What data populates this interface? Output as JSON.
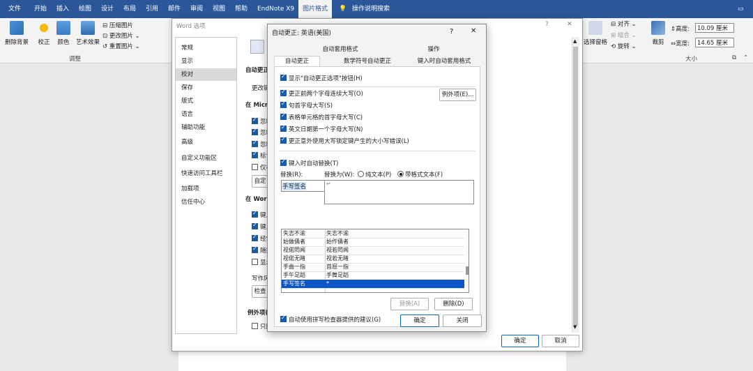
{
  "ribbon": {
    "tabs": [
      "文件",
      "开始",
      "插入",
      "绘图",
      "设计",
      "布局",
      "引用",
      "邮件",
      "审阅",
      "视图",
      "帮助",
      "EndNote X9",
      "图片格式",
      "操作说明搜索"
    ],
    "active_tab": "图片格式",
    "left_buttons": [
      "删除背景",
      "校正",
      "颜色",
      "艺术效果"
    ],
    "small_buttons": [
      "压缩图片",
      "更改图片",
      "重置图片"
    ],
    "group_adjust": "调整",
    "right_small": [
      "对齐",
      "组合",
      "旋转"
    ],
    "select_pane": "选择窗格",
    "crop": "裁剪",
    "height_label": "高度:",
    "height_value": "10.09 厘米",
    "width_label": "宽度:",
    "width_value": "14.65 厘米",
    "group_size": "大小"
  },
  "word_options": {
    "title": "Word 选项",
    "nav": [
      "常规",
      "显示",
      "校对",
      "保存",
      "版式",
      "语言",
      "辅助功能",
      "高级",
      "自定义功能区",
      "快速访问工具栏",
      "加载项",
      "信任中心"
    ],
    "nav_selected": "校对",
    "section_autocorrect": "自动更正",
    "change_text": "更改键",
    "section_micro": "在 Micro",
    "checks_micro": [
      "忽略",
      "忽略",
      "忽略",
      "标记",
      "仅根"
    ],
    "btn_custom": "自定",
    "section_word": "在 Word",
    "checks_word": [
      "键入",
      "键入",
      "经常",
      "随拼",
      "显示"
    ],
    "writing_label": "写作风",
    "btn_check": "检查",
    "exception_label": "例外项(",
    "only_label": "只隐",
    "ok": "确定",
    "cancel": "取消",
    "help": "?",
    "close": "✕"
  },
  "autocorrect": {
    "title": "自动更正: 英语(美国)",
    "help": "?",
    "close": "✕",
    "tabs_row1": [
      "自动套用格式",
      "操作"
    ],
    "tabs_row2": [
      "自动更正",
      "数学符号自动更正",
      "键入时自动套用格式"
    ],
    "show_buttons": "显示\"自动更正选项\"按钮(H)",
    "options": [
      "更正前两个字母连续大写(O)",
      "句首字母大写(S)",
      "表格单元格的首字母大写(C)",
      "英文日期第一个字母大写(N)",
      "更正意外使用大写锁定键产生的大小写错误(L)"
    ],
    "exceptions_btn": "例外项(E)...",
    "replace_as_type": "键入时自动替换(T)",
    "replace_label": "替换(R):",
    "with_label": "替换为(W):",
    "plain_text": "纯文本(P)",
    "formatted_text": "带格式文本(F)",
    "replace_value": "手写签名",
    "with_value": "↵",
    "rows": [
      [
        "失志不渝",
        "矢志不渝"
      ],
      [
        "始做俑者",
        "始作俑者"
      ],
      [
        "视偌罔闻",
        "视若罔闻"
      ],
      [
        "视偌无睹",
        "视若无睹"
      ],
      [
        "手曲一指",
        "首屈一指"
      ],
      [
        "手午足蹈",
        "手舞足蹈"
      ],
      [
        "手写签名",
        "*"
      ]
    ],
    "btn_replace": "替换(A)",
    "btn_delete": "删除(D)",
    "spell_suggest": "自动使用拼写检查器提供的建议(G)",
    "ok": "确定",
    "close_btn": "关闭"
  }
}
